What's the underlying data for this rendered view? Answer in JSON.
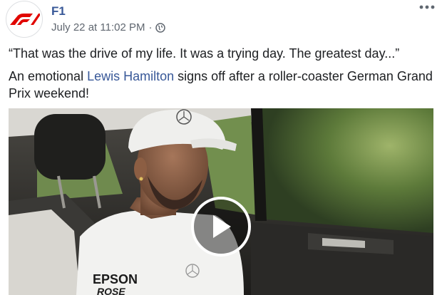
{
  "post": {
    "page_name": "F1",
    "timestamp": "July 22 at 11:02 PM",
    "separator": "·",
    "privacy_icon": "globe-icon",
    "more_icon": "more-options-icon",
    "avatar_icon": "f1-logo",
    "quote": "“That was the drive of my life. It was a trying day. The greatest day...”",
    "caption_prefix": "An emotional ",
    "mention": "Lewis Hamilton",
    "caption_suffix": " signs off after a roller-coaster German Grand Prix weekend!",
    "video": {
      "play_icon": "play-icon",
      "shirt_text_1": "EPSON",
      "shirt_text_2": "ROSE",
      "colors": {
        "brand_red": "#e10600",
        "link_blue": "#385898",
        "meta_gray": "#606770"
      }
    }
  }
}
